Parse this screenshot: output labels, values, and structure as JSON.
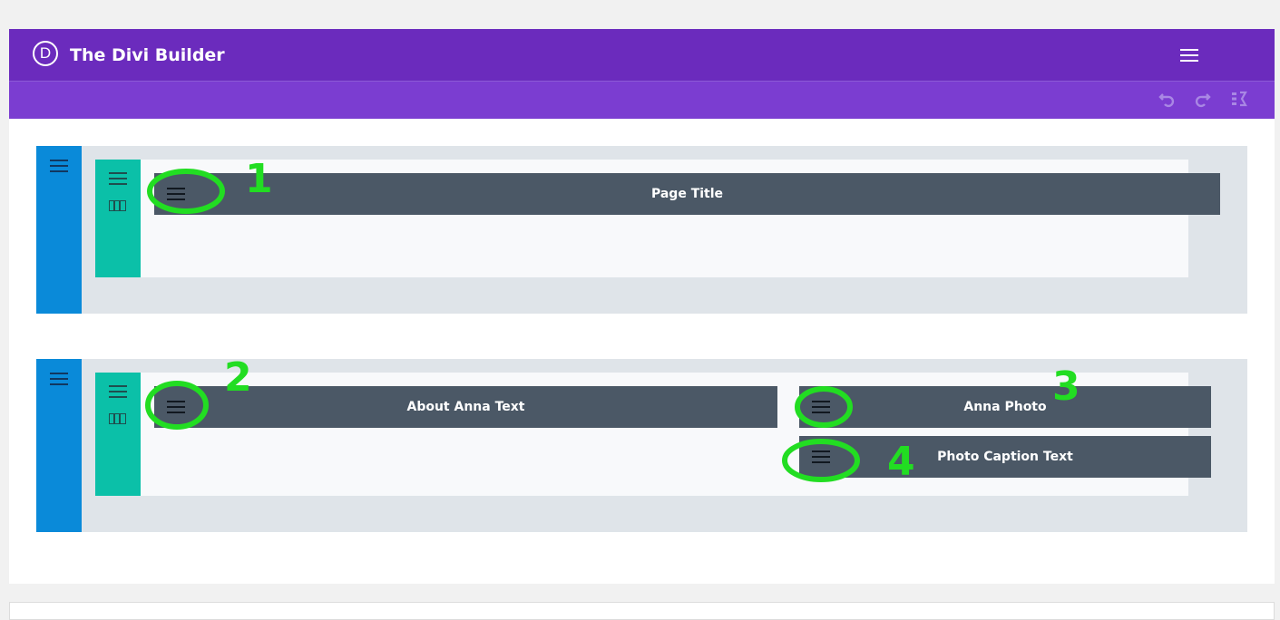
{
  "header": {
    "logo_letter": "D",
    "title": "The Divi Builder",
    "menu_icon": "hamburger-icon"
  },
  "toolbar": {
    "icons": [
      "undo-icon",
      "redo-icon",
      "history-icon"
    ]
  },
  "sections": [
    {
      "rows": [
        {
          "modules": [
            {
              "label": "Page Title"
            }
          ]
        }
      ]
    },
    {
      "rows": [
        {
          "modules": [
            {
              "label": "About Anna Text"
            },
            {
              "label": "Anna Photo"
            },
            {
              "label": "Photo Caption Text"
            }
          ]
        }
      ]
    }
  ],
  "annotations": [
    "1",
    "2",
    "3",
    "4"
  ],
  "colors": {
    "header": "#6b2bbd",
    "toolbar": "#7b3dd1",
    "section_handle": "#0a8ad9",
    "row_handle": "#0bc0a8",
    "module": "#4b5866",
    "annotation": "#22dd22"
  }
}
